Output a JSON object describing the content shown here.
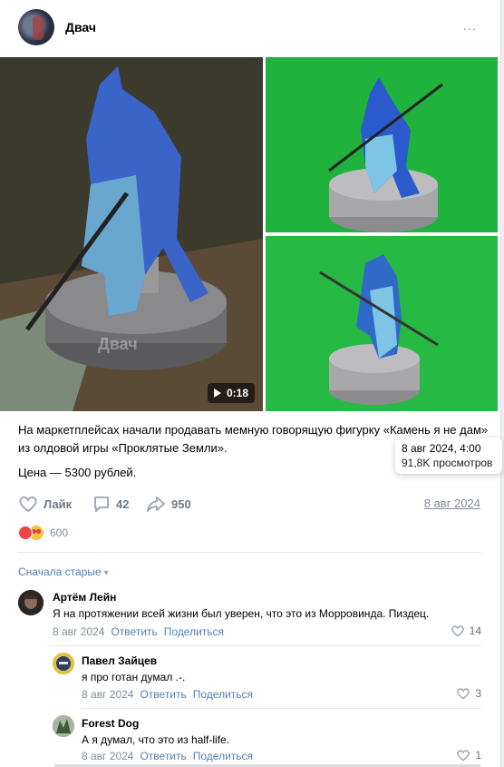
{
  "post": {
    "group_name": "Двач",
    "more_icon": "…",
    "video_duration": "0:18",
    "watermark": "Двач",
    "text": "На маркетплейсах начали продавать мемную говорящую фигурку «Камень я не дам» из олдовой игры «Проклятые Земли».",
    "price": "Цена — 5300 рублей.",
    "like_label": "Лайк",
    "comments_count": "42",
    "shares_count": "950",
    "date": "8 авг 2024",
    "reactions_count": "600"
  },
  "tooltip": {
    "datetime": "8 авг 2024, 4:00",
    "views": "91,8K просмотров"
  },
  "comments_sort": "Сначала старые",
  "comments": [
    {
      "author": "Артём Лейн",
      "text": "Я на протяжении всей жизни был уверен, что это из Морровинда. Пиздец.",
      "date": "8 авг 2024",
      "reply": "Ответить",
      "share": "Поделиться",
      "likes": "14"
    },
    {
      "author": "Павел Зайцев",
      "text": "я про готан думал .-.",
      "date": "8 авг 2024",
      "reply": "Ответить",
      "share": "Поделиться",
      "likes": "3"
    },
    {
      "author": "Forest Dog",
      "text": "А я думал, что это из half-life.",
      "date": "8 авг 2024",
      "reply": "Ответить",
      "share": "Поделиться",
      "likes": "1"
    }
  ],
  "colors": {
    "link": "#5181b8",
    "muted": "#818c99",
    "green_screen": "#1fb23d"
  }
}
